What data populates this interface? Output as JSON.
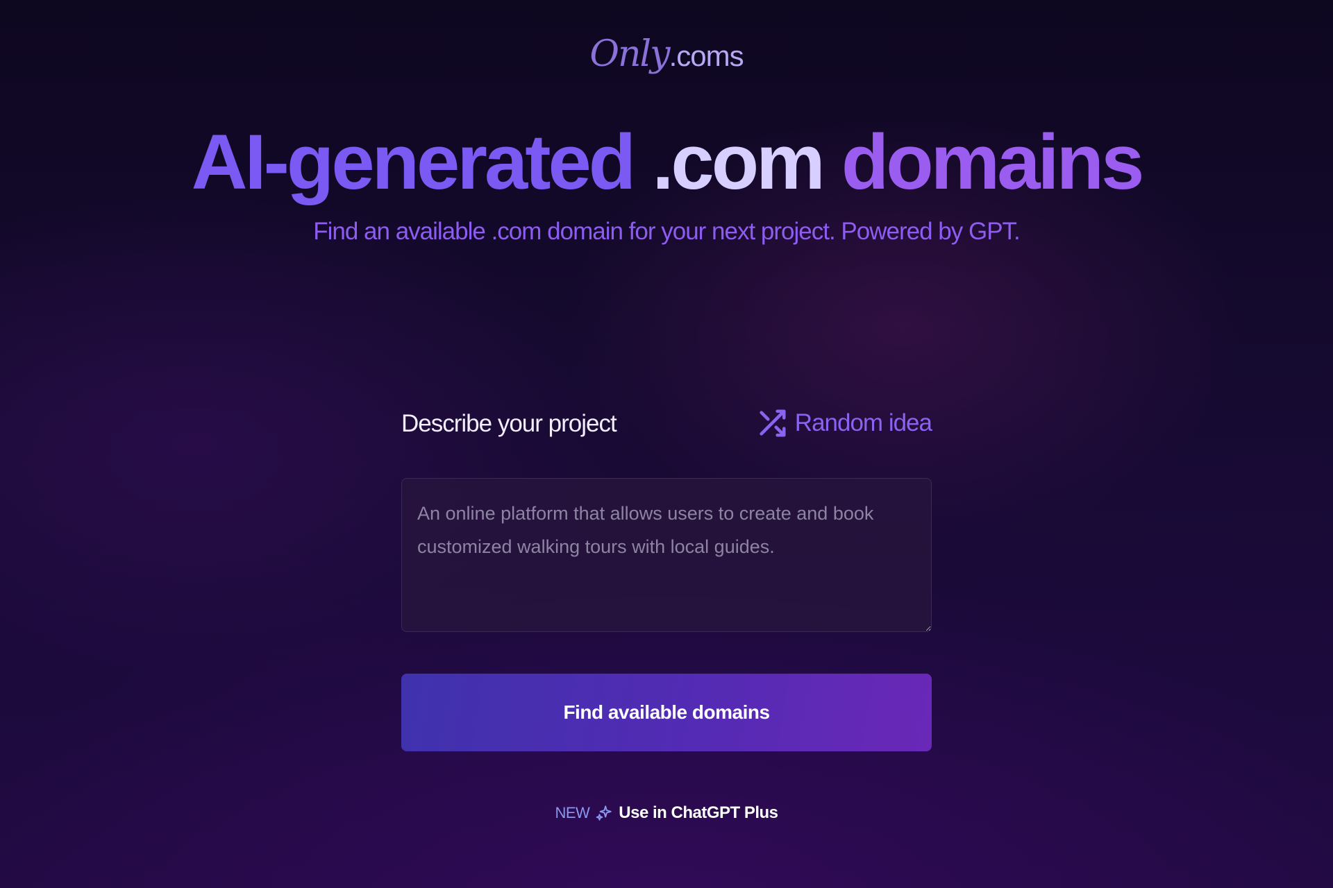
{
  "logo": {
    "script_text": "Only",
    "suffix_text": ".coms"
  },
  "hero": {
    "title_part1": "AI-generated",
    "title_part2": ".com",
    "title_part3": "domains",
    "subtitle": "Find an available .com domain for your next project. Powered by GPT."
  },
  "form": {
    "label": "Describe your project",
    "random_idea": {
      "icon": "shuffle-icon",
      "label": "Random idea"
    },
    "input": {
      "value": "",
      "placeholder": "An online platform that allows users to create and book customized walking tours with local guides."
    },
    "submit_label": "Find available domains"
  },
  "footer_link": {
    "badge": "NEW",
    "icon": "sparkle-icon",
    "label": "Use in ChatGPT Plus"
  },
  "colors": {
    "accent_purple": "#8a63f0",
    "title_violet": "#7a5af2",
    "title_light": "#d7cfff",
    "title_pink_violet": "#9b5cf0",
    "button_gradient_start": "#3f32ad",
    "button_gradient_end": "#6a28b7",
    "background_dark": "#140a2c"
  }
}
